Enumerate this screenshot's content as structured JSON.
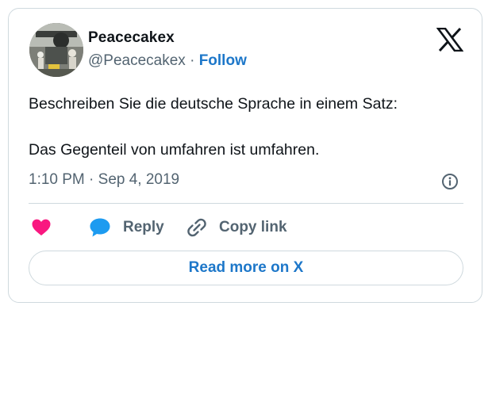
{
  "tweet": {
    "author_name": "Peacecakex",
    "author_handle": "@Peacecakex",
    "separator": "·",
    "follow_label": "Follow",
    "text_lines": [
      "Beschreiben Sie die deutsche Sprache in einem Satz:",
      "Das Gegenteil von umfahren ist umfahren."
    ],
    "timestamp": "1:10 PM · Sep 4, 2019"
  },
  "actions": {
    "like_icon": "heart-icon",
    "reply_icon": "speech-bubble-icon",
    "reply_label": "Reply",
    "copy_icon": "link-icon",
    "copy_label": "Copy link"
  },
  "footer": {
    "read_more_label": "Read more on X"
  },
  "colors": {
    "accent": "#1d77c9",
    "heart": "#f91880",
    "reply_icon": "#1d9bf0",
    "secondary_text": "#536471",
    "border": "#cfd9de"
  }
}
